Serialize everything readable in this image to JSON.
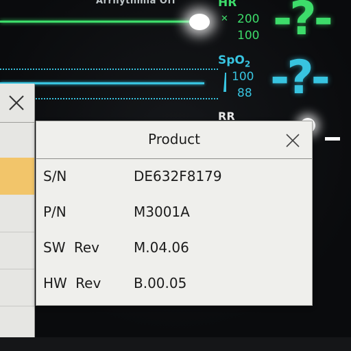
{
  "monitor": {
    "arrhythmia_status": "Arrhythmia Off",
    "hr": {
      "label": "HR",
      "alarm_icon": "bell-off-icon",
      "alarm_high": "200",
      "alarm_low": "100",
      "value": "-?-",
      "color": "#3ddc6a"
    },
    "spo2": {
      "label": "SpO2",
      "alarm_high": "100",
      "alarm_low": "88",
      "value": "-?-",
      "color": "#38c4e0"
    },
    "rr": {
      "label": "RR"
    }
  },
  "dialog": {
    "title": "Product",
    "close_icon": "close-icon",
    "rows": [
      {
        "label": "S/N",
        "value": "DE632F8179"
      },
      {
        "label": "P/N",
        "value": "M3001A"
      },
      {
        "label": "SW Rev",
        "value": "M.04.06"
      },
      {
        "label": "HW Rev",
        "value": "B.00.05"
      }
    ]
  },
  "back_window": {
    "close_icon": "close-icon",
    "highlight_color": "#f2c56a"
  }
}
